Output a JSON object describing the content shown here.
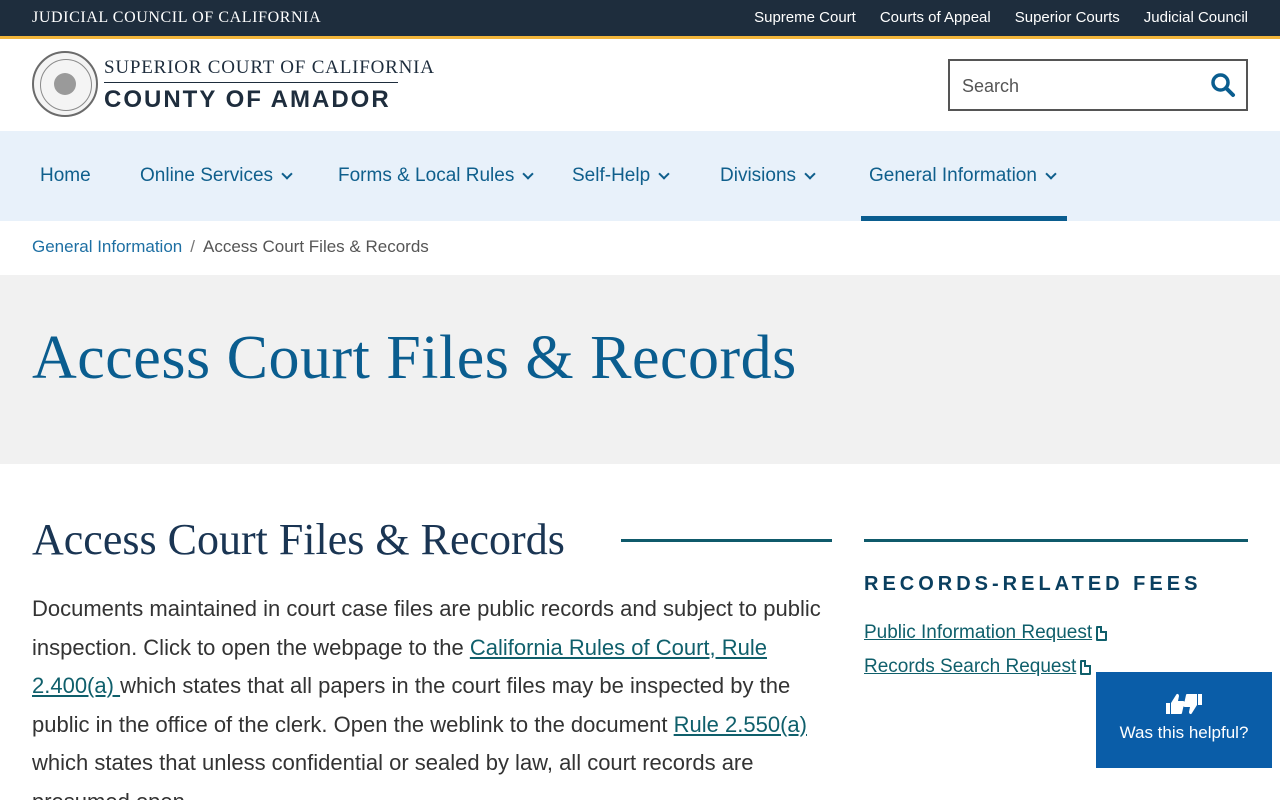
{
  "topbar": {
    "title": "JUDICIAL COUNCIL OF CALIFORNIA",
    "links": [
      "Supreme Court",
      "Courts of Appeal",
      "Superior Courts",
      "Judicial Council"
    ]
  },
  "header": {
    "logo_line1": "SUPERIOR COURT OF CALIFORNIA",
    "logo_line2": "COUNTY OF AMADOR",
    "search_placeholder": "Search"
  },
  "nav": {
    "items": [
      {
        "label": "Home"
      },
      {
        "label": "Online Services"
      },
      {
        "label": "Forms & Local Rules"
      },
      {
        "label": "Self-Help"
      },
      {
        "label": "Divisions"
      },
      {
        "label": "General Information"
      }
    ],
    "active": "General Information"
  },
  "breadcrumb": {
    "parent": "General Information",
    "separator": "/",
    "current": "Access Court Files & Records"
  },
  "hero": {
    "title": "Access Court Files & Records"
  },
  "main": {
    "heading": "Access Court Files & Records",
    "p1": "Documents maintained in court case files are public records and subject to public inspection. Click to open the webpage to the ",
    "link1": "California Rules of Court, Rule 2.400(a) ",
    "p2": "which states that all papers in the court files may be inspected by the public in the office of the clerk. Open the weblink to the document ",
    "link2": "Rule 2.550(a) ",
    "p3": "which states that unless confidential or sealed by law, all court records are presumed open."
  },
  "sidebar": {
    "title": "RECORDS-RELATED FEES",
    "links": [
      "Public Information Request",
      "Records Search Request"
    ]
  },
  "helpful": {
    "label": "Was this helpful?"
  },
  "colors": {
    "topbar": "#1e2d3d",
    "gold_accent": "#f2b53a",
    "nav_bg": "#e8f1fa",
    "brand_blue": "#0a5d8f",
    "link_teal": "#0f5f6b",
    "helpful_bg": "#0a5da8"
  },
  "icons": [
    "court-seal-icon",
    "search-icon",
    "chevron-down-icon",
    "file-icon",
    "thumbs-up-down-icon"
  ]
}
